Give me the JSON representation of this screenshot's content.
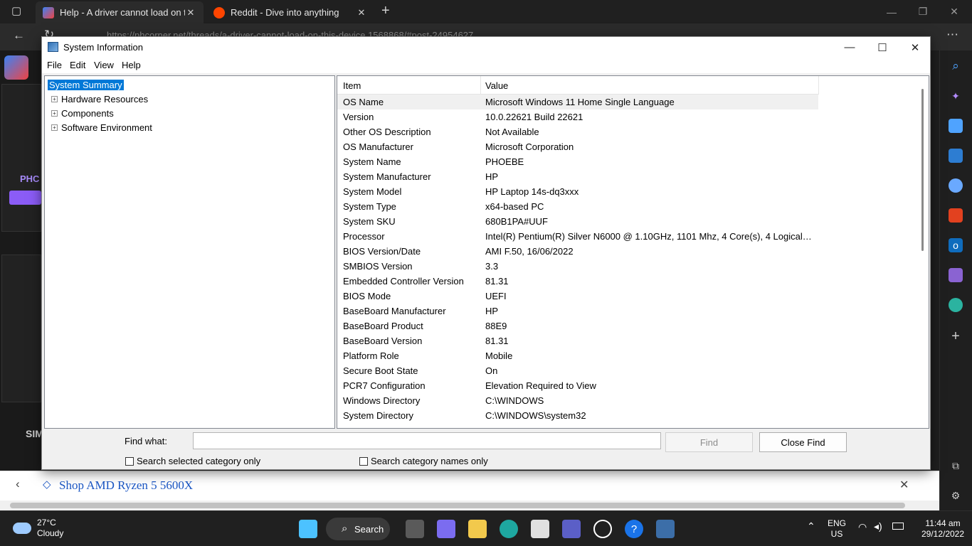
{
  "browser": {
    "tabs": [
      {
        "title": "Help - A driver cannot load on th",
        "close": "✕"
      },
      {
        "title": "Reddit - Dive into anything",
        "close": "✕"
      }
    ],
    "new_tab": "+",
    "url": "https://phcorner.net/threads/a-driver-cannot-load-on-this-device.1568868/#post-24954627"
  },
  "page": {
    "side_label_1": "PHC",
    "side_label_2": "SIM",
    "ad_text": "Shop AMD Ryzen 5 5600X",
    "ad_close": "✕"
  },
  "window": {
    "title": "System Information",
    "menu": [
      "File",
      "Edit",
      "View",
      "Help"
    ],
    "tree": [
      {
        "label": "System Summary",
        "selected": true
      },
      {
        "label": "Hardware Resources",
        "expander": "+"
      },
      {
        "label": "Components",
        "expander": "+"
      },
      {
        "label": "Software Environment",
        "expander": "+"
      }
    ],
    "list": {
      "headers": [
        "Item",
        "Value"
      ],
      "rows": [
        [
          "OS Name",
          "Microsoft Windows 11 Home Single Language"
        ],
        [
          "Version",
          "10.0.22621 Build 22621"
        ],
        [
          "Other OS Description",
          "Not Available"
        ],
        [
          "OS Manufacturer",
          "Microsoft Corporation"
        ],
        [
          "System Name",
          "PHOEBE"
        ],
        [
          "System Manufacturer",
          "HP"
        ],
        [
          "System Model",
          "HP Laptop 14s-dq3xxx"
        ],
        [
          "System Type",
          "x64-based PC"
        ],
        [
          "System SKU",
          "680B1PA#UUF"
        ],
        [
          "Processor",
          "Intel(R) Pentium(R) Silver N6000 @ 1.10GHz, 1101 Mhz, 4 Core(s), 4 Logical Pr..."
        ],
        [
          "BIOS Version/Date",
          "AMI F.50, 16/06/2022"
        ],
        [
          "SMBIOS Version",
          "3.3"
        ],
        [
          "Embedded Controller Version",
          "81.31"
        ],
        [
          "BIOS Mode",
          "UEFI"
        ],
        [
          "BaseBoard Manufacturer",
          "HP"
        ],
        [
          "BaseBoard Product",
          "88E9"
        ],
        [
          "BaseBoard Version",
          "81.31"
        ],
        [
          "Platform Role",
          "Mobile"
        ],
        [
          "Secure Boot State",
          "On"
        ],
        [
          "PCR7 Configuration",
          "Elevation Required to View"
        ],
        [
          "Windows Directory",
          "C:\\WINDOWS"
        ],
        [
          "System Directory",
          "C:\\WINDOWS\\system32"
        ]
      ]
    },
    "find": {
      "label": "Find what:",
      "value": "",
      "find_button": "Find",
      "close_button": "Close Find",
      "check_selected": "Search selected category only",
      "check_names": "Search category names only"
    }
  },
  "taskbar": {
    "temperature": "27°C",
    "condition": "Cloudy",
    "search_label": "Search",
    "language": "ENG",
    "region": "US",
    "time": "11:44 am",
    "date": "29/12/2022"
  },
  "colors": {
    "selection": "#0078d7",
    "link": "#1a56c4",
    "taskbar": "#202020"
  }
}
